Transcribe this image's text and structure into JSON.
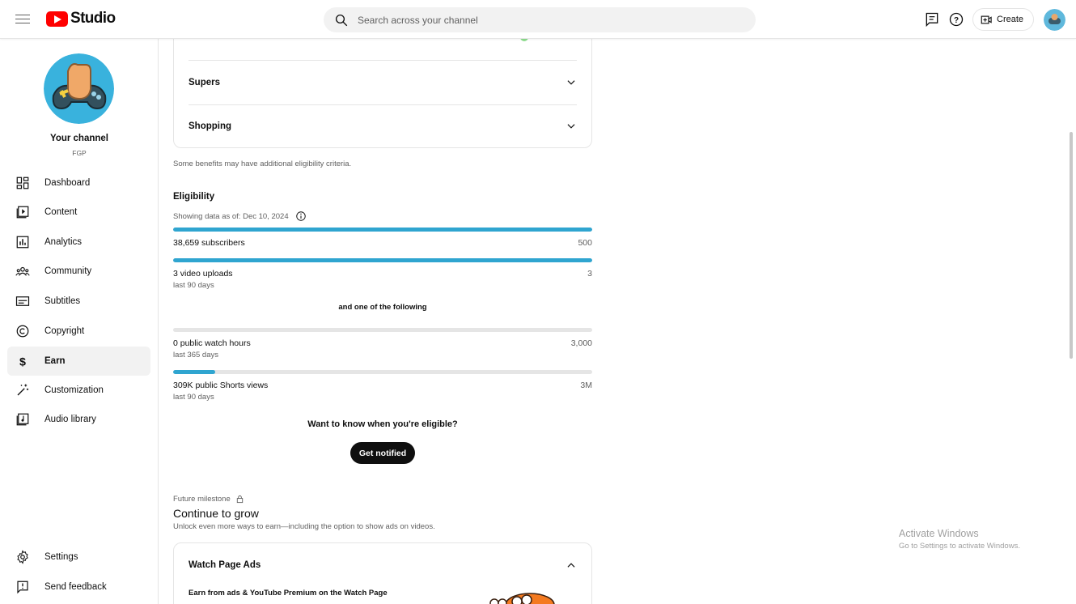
{
  "header": {
    "logo_text": "Studio",
    "search_placeholder": "Search across your channel",
    "create_label": "Create"
  },
  "sidebar": {
    "channel_title": "Your channel",
    "channel_handle": "FGP",
    "items": [
      {
        "label": "Dashboard",
        "icon": "dashboard-icon"
      },
      {
        "label": "Content",
        "icon": "content-icon"
      },
      {
        "label": "Analytics",
        "icon": "analytics-icon"
      },
      {
        "label": "Community",
        "icon": "community-icon"
      },
      {
        "label": "Subtitles",
        "icon": "subtitles-icon"
      },
      {
        "label": "Copyright",
        "icon": "copyright-icon"
      },
      {
        "label": "Earn",
        "icon": "dollar-icon",
        "active": true
      },
      {
        "label": "Customization",
        "icon": "magic-wand-icon"
      },
      {
        "label": "Audio library",
        "icon": "audio-library-icon"
      }
    ],
    "bottom_items": [
      {
        "label": "Settings",
        "icon": "gear-icon"
      },
      {
        "label": "Send feedback",
        "icon": "feedback-icon"
      }
    ]
  },
  "benefits": {
    "rows": [
      "Supers",
      "Shopping"
    ],
    "note": "Some benefits may have additional eligibility criteria."
  },
  "eligibility": {
    "title": "Eligibility",
    "data_date": "Showing data as of: Dec 10, 2024",
    "metrics": [
      {
        "label": "38,659 subscribers",
        "target": "500",
        "sub": "",
        "progress": 1.0
      },
      {
        "label": "3 video uploads",
        "target": "3",
        "sub": "last 90 days",
        "progress": 1.0
      },
      {
        "label": "0 public watch hours",
        "target": "3,000",
        "sub": "last 365 days",
        "progress": 0.0
      },
      {
        "label": "309K public Shorts views",
        "target": "3M",
        "sub": "last 90 days",
        "progress": 0.1
      }
    ],
    "separator": "and one of the following",
    "notify_question": "Want to know when you're eligible?",
    "notify_button": "Get notified"
  },
  "milestone": {
    "kicker": "Future milestone",
    "title": "Continue to grow",
    "description": "Unlock even more ways to earn—including the option to show ads on videos.",
    "section_title": "Watch Page Ads",
    "section_subtitle": "Earn from ads & YouTube Premium on the Watch Page"
  },
  "watermark": {
    "line1": "Activate Windows",
    "line2": "Go to Settings to activate Windows."
  },
  "colors": {
    "progress": "#2fa5d0",
    "brand_red": "#ff0000",
    "active_bg": "#f2f2f2"
  }
}
